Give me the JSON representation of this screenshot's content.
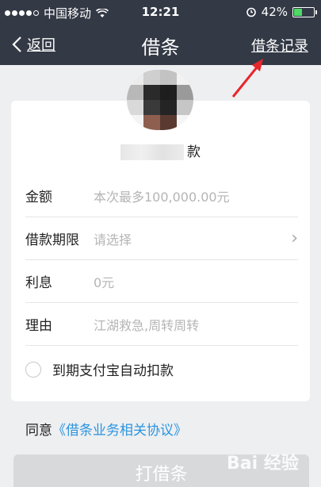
{
  "status_bar": {
    "carrier": "中国移动",
    "time": "12:21",
    "battery_percent": "42%",
    "battery_level": 0.42,
    "icons": [
      "signal-dots-icon",
      "wifi-icon",
      "alarm-icon",
      "battery-icon"
    ]
  },
  "nav": {
    "back_label": "返回",
    "title": "借条",
    "record_label": "借条记录"
  },
  "profile": {
    "name_suffix": "款"
  },
  "form": {
    "rows": [
      {
        "label": "金额",
        "placeholder": "本次最多100,000.00元"
      },
      {
        "label": "借款期限",
        "placeholder": "请选择"
      },
      {
        "label": "利息",
        "placeholder": "0元"
      },
      {
        "label": "理由",
        "placeholder": "江湖救急,周转周转"
      }
    ],
    "auto_pay_label": "到期支付宝自动扣款"
  },
  "agreement": {
    "prefix": "同意",
    "link": "《借条业务相关协议》"
  },
  "submit_label": "打借条",
  "watermark": "Bai 经验",
  "colors": {
    "nav_bg": "#333945",
    "link": "#2a95e0",
    "page_bg": "#eeeff1",
    "annotation_arrow": "#e8262b",
    "battery": "#4cd964"
  }
}
